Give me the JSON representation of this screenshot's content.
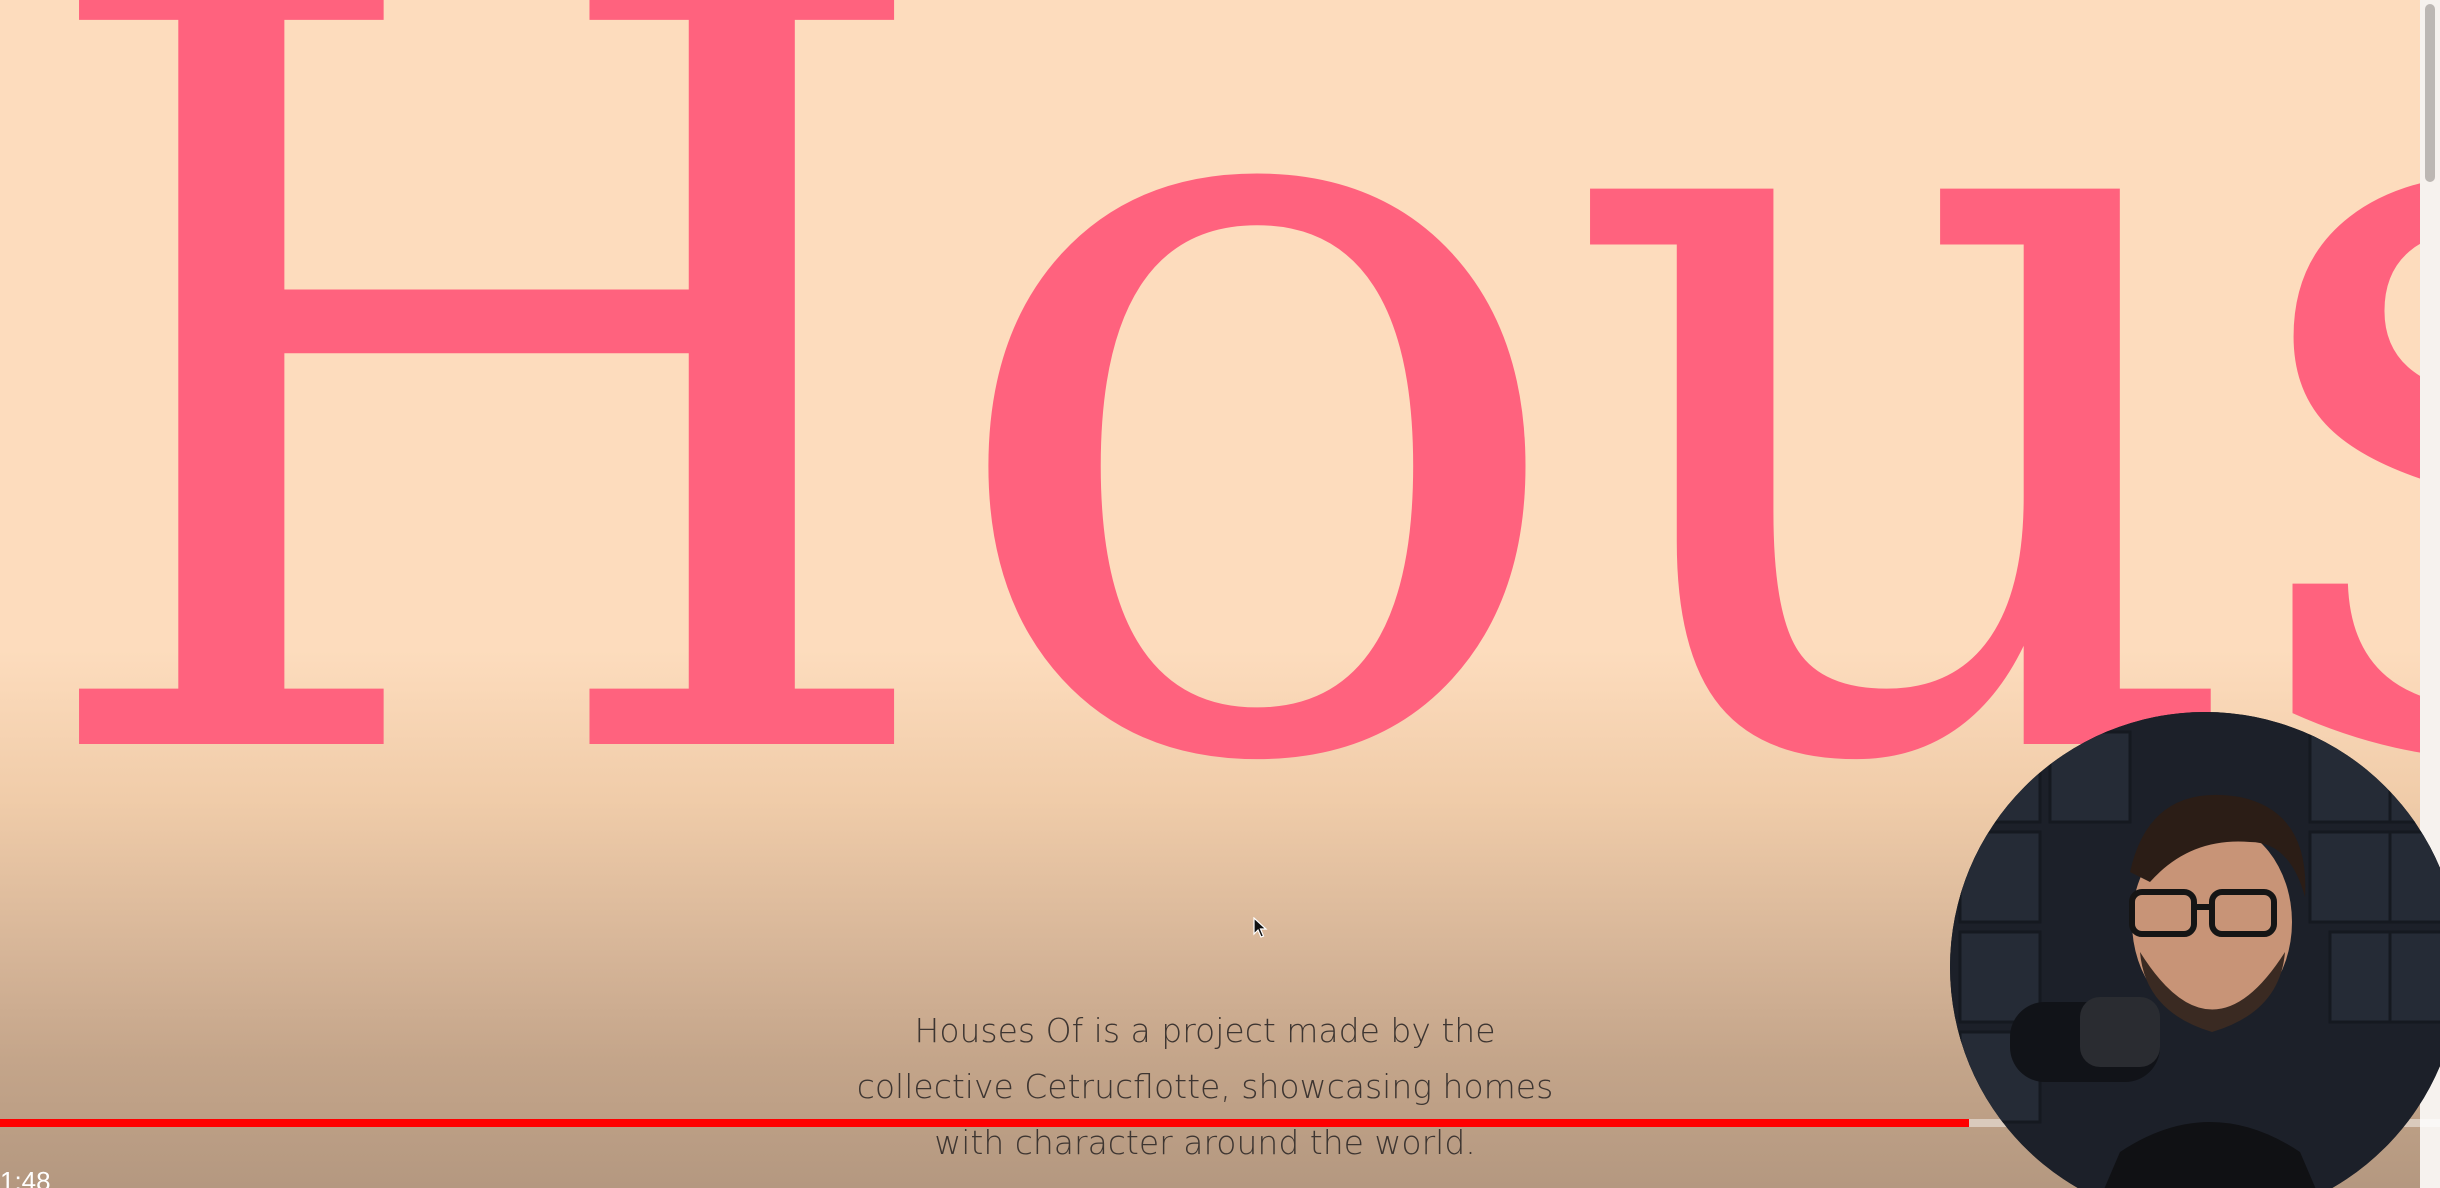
{
  "hero": {
    "word": "Houses"
  },
  "description": {
    "lines": [
      "Houses Of is a project made by the",
      "collective Cetrucflotte, showcasing homes",
      "with character around the world."
    ]
  },
  "video_player": {
    "progress_fraction": 0.807,
    "time_display": "1:48",
    "progress_color": "#ff0000"
  },
  "colors": {
    "background_top": "#fddcbd",
    "hero_text": "#ff627e",
    "body_text": "#3d3531"
  },
  "icons": {
    "cursor": "mouse-pointer-icon"
  }
}
